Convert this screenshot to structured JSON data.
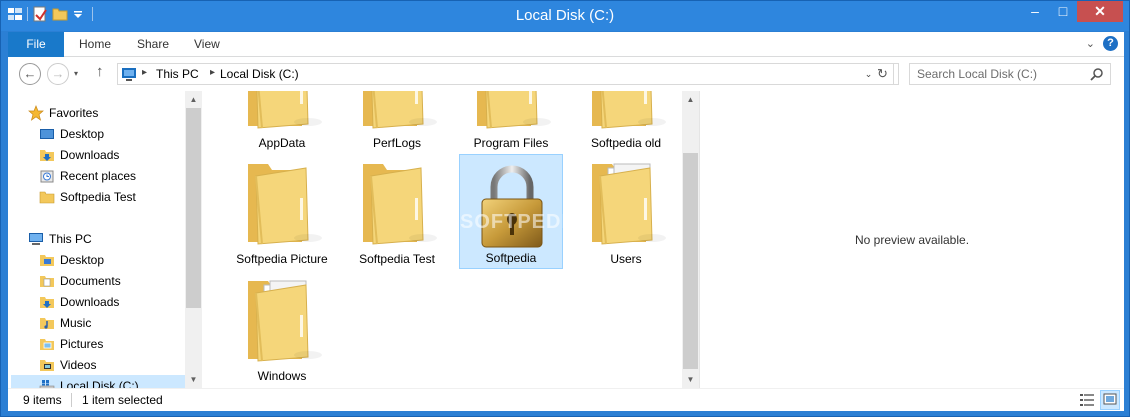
{
  "window": {
    "title": "Local Disk (C:)"
  },
  "ribbon": {
    "tabs": [
      "File",
      "Home",
      "Share",
      "View"
    ]
  },
  "address": {
    "crumbs": [
      "This PC",
      "Local Disk (C:)"
    ],
    "search_placeholder": "Search Local Disk (C:)"
  },
  "nav": {
    "favorites_label": "Favorites",
    "favorites": [
      "Desktop",
      "Downloads",
      "Recent places",
      "Softpedia Test"
    ],
    "thispc_label": "This PC",
    "thispc": [
      "Desktop",
      "Documents",
      "Downloads",
      "Music",
      "Pictures",
      "Videos",
      "Local Disk (C:)"
    ]
  },
  "files": [
    {
      "name": "AppData",
      "type": "folder"
    },
    {
      "name": "PerfLogs",
      "type": "folder"
    },
    {
      "name": "Program Files",
      "type": "folder-docs"
    },
    {
      "name": "Softpedia old",
      "type": "folder"
    },
    {
      "name": "Softpedia Picture",
      "type": "folder"
    },
    {
      "name": "Softpedia Test",
      "type": "folder"
    },
    {
      "name": "Softpedia",
      "type": "locked",
      "selected": true,
      "watermark": "SOFTPEDIA"
    },
    {
      "name": "Users",
      "type": "folder-docs"
    },
    {
      "name": "Windows",
      "type": "folder-docs"
    }
  ],
  "preview": {
    "message": "No preview available."
  },
  "status": {
    "items": "9 items",
    "selected": "1 item selected"
  },
  "colors": {
    "titlebar": "#2e86de",
    "file_tab": "#1979ca",
    "selection": "#cce8ff",
    "folder": "#f5d67a"
  }
}
